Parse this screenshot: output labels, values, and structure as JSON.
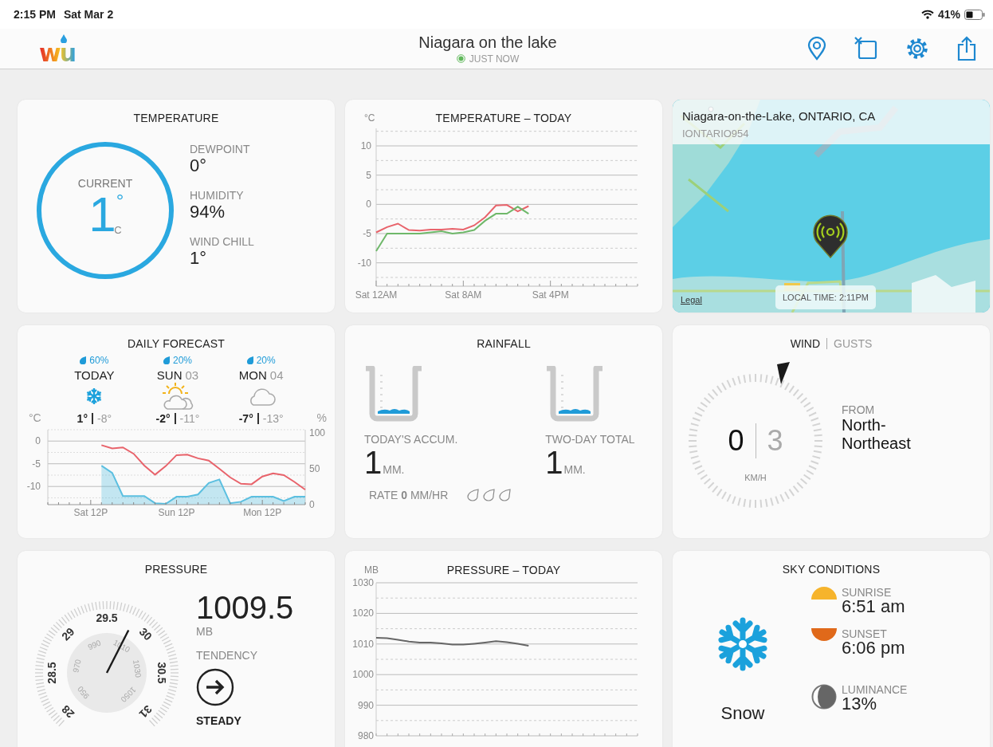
{
  "status_bar": {
    "time": "2:15 PM",
    "date": "Sat Mar 2",
    "battery": "41%"
  },
  "header": {
    "logo": "wu",
    "title": "Niagara on the lake",
    "updated": "JUST NOW"
  },
  "toolbar": [
    {
      "kind": "location"
    },
    {
      "kind": "remove-tile"
    },
    {
      "kind": "settings"
    },
    {
      "kind": "share"
    }
  ],
  "temperature": {
    "title": "TEMPERATURE",
    "current_label": "CURRENT",
    "value": "1",
    "degree": "°",
    "unit": "C",
    "stats": [
      {
        "label": "DEWPOINT",
        "value": "0°"
      },
      {
        "label": "HUMIDITY",
        "value": "94%"
      },
      {
        "label": "WIND CHILL",
        "value": "1°"
      }
    ]
  },
  "temperature_today": {
    "title": "TEMPERATURE – TODAY",
    "chart_data": {
      "type": "line",
      "grid": true,
      "ylabel": "°C",
      "categories": [
        "Sat 12AM",
        null,
        null,
        null,
        null,
        null,
        null,
        null,
        "Sat 8AM",
        null,
        null,
        null,
        null,
        null,
        null,
        null,
        "Sat 4PM",
        null,
        null,
        null,
        null,
        null,
        null,
        null,
        null
      ],
      "ylim": [
        -14,
        13
      ],
      "yticks": [
        -10,
        -5,
        0,
        5,
        10
      ],
      "series": [
        {
          "color": "#e8636b",
          "values": [
            -4.8,
            -3.9,
            -3.3,
            -4.4,
            -4.5,
            -4.3,
            -4.3,
            -4.2,
            -4.3,
            -3.6,
            -2.2,
            -0.2,
            -0.1,
            -1.2,
            -0.3,
            null,
            null,
            null,
            null,
            null,
            null,
            null,
            null,
            null,
            null
          ]
        },
        {
          "color": "#6fb86a",
          "values": [
            -8,
            -5,
            -5,
            -5,
            -5,
            -4.8,
            -4.6,
            -5,
            -4.8,
            -4.4,
            -2.8,
            -1.6,
            -1.6,
            -0.4,
            -1.6,
            null,
            null,
            null,
            null,
            null,
            null,
            null,
            null,
            null,
            null
          ]
        }
      ]
    }
  },
  "map": {
    "location": "Niagara-on-the-Lake, ONTARIO, CA",
    "station": "IONTARIO954",
    "local_time": "LOCAL TIME: 2:11PM",
    "legal": "Legal"
  },
  "daily_forecast": {
    "title": "DAILY FORECAST",
    "temp_unit": "°C",
    "precip_unit": "%",
    "days": [
      {
        "precip": "60%",
        "day": "TODAY",
        "kind": "snow",
        "high": "1°",
        "low": "-8°"
      },
      {
        "precip": "20%",
        "day": "SUN",
        "date": "03",
        "kind": "partly-sunny",
        "high": "-2°",
        "low": "-11°"
      },
      {
        "precip": "20%",
        "day": "MON",
        "date": "04",
        "kind": "cloudy",
        "high": "-7°",
        "low": "-13°"
      }
    ],
    "chart_data": {
      "type": "line",
      "categories": [
        null,
        null,
        null,
        null,
        "Sat 12P",
        null,
        null,
        null,
        null,
        null,
        null,
        null,
        "Sun 12P",
        null,
        null,
        null,
        null,
        null,
        null,
        null,
        "Mon 12P",
        null,
        null,
        null,
        null
      ],
      "grid": true,
      "ylim": [
        -14,
        2.5
      ],
      "y2lim": [
        0,
        104
      ],
      "yticks": [
        -10,
        -5,
        0
      ],
      "y2ticks": [
        0,
        50,
        100
      ],
      "series": [
        {
          "color": "#e8636b",
          "values": [
            null,
            null,
            null,
            null,
            null,
            -0.9,
            -1.6,
            -1.4,
            -2.8,
            -5.4,
            -7.4,
            -5.5,
            -3.1,
            -3,
            -3.8,
            -4.3,
            -6.1,
            -8,
            -9.4,
            -9.5,
            -7.8,
            -7.1,
            -7.5,
            -9,
            -10.7
          ]
        },
        {
          "color": "#5bbfe0",
          "axis": "y2",
          "values": [
            null,
            null,
            null,
            null,
            null,
            54,
            44,
            12,
            12,
            12,
            2,
            1,
            11,
            11,
            14,
            30,
            35,
            2,
            4,
            11,
            11,
            11,
            5,
            11,
            11
          ]
        }
      ]
    }
  },
  "rainfall": {
    "title": "RAINFALL",
    "gauges": [
      {
        "label": "TODAY'S ACCUM.",
        "value": "1",
        "unit": "MM."
      },
      {
        "label": "TWO-DAY TOTAL",
        "value": "1",
        "unit": "MM."
      }
    ],
    "rate": "RATE **0** MM/HR"
  },
  "wind": {
    "tabs": [
      {
        "label": "WIND",
        "selected": true
      },
      {
        "label": "GUSTS",
        "selected": false
      }
    ],
    "speed": "0",
    "gust": "3",
    "unit": "KM/H",
    "from_label": "FROM",
    "direction": "North-Northeast"
  },
  "pressure": {
    "title": "PRESSURE",
    "value": "1009.5",
    "unit": "MB",
    "tendency_label": "TENDENCY",
    "tendency": "STEADY",
    "gauge": {
      "level": 0.6,
      "outer_labels": [
        "28",
        "28.5",
        "29",
        "29.5",
        "30",
        "30.5",
        "31"
      ],
      "inner_labels": [
        "950",
        "970",
        "990",
        "1010",
        "1030",
        "1050"
      ]
    }
  },
  "pressure_today": {
    "title": "PRESSURE – TODAY",
    "chart_data": {
      "type": "line",
      "grid": true,
      "ylabel": "MB",
      "categories": [
        null,
        null,
        null,
        null,
        null,
        null,
        null,
        null,
        null,
        null,
        null,
        null,
        null,
        null,
        null,
        null,
        null,
        null,
        null,
        null,
        null,
        null,
        null,
        null,
        null
      ],
      "ylim": [
        980,
        1030
      ],
      "yticks": [
        980,
        990,
        1000,
        1010,
        1020,
        1030
      ],
      "series": [
        {
          "color": "#666666",
          "values": [
            1012,
            1011.9,
            1011.4,
            1010.8,
            1010.5,
            1010.5,
            1010.2,
            1009.8,
            1009.8,
            1010.1,
            1010.5,
            1010.9,
            1010.6,
            1010.1,
            1009.4,
            null,
            null,
            null,
            null,
            null,
            null,
            null,
            null,
            null,
            null
          ]
        }
      ]
    }
  },
  "sky": {
    "title": "SKY CONDITIONS",
    "condition": "Snow",
    "items": [
      {
        "kind": "sunrise",
        "label": "SUNRISE",
        "value": "6:51 am"
      },
      {
        "kind": "sunset",
        "label": "SUNSET",
        "value": "6:06 pm"
      },
      {
        "kind": "moon",
        "label": "LUMINANCE",
        "value": "13%"
      }
    ]
  }
}
